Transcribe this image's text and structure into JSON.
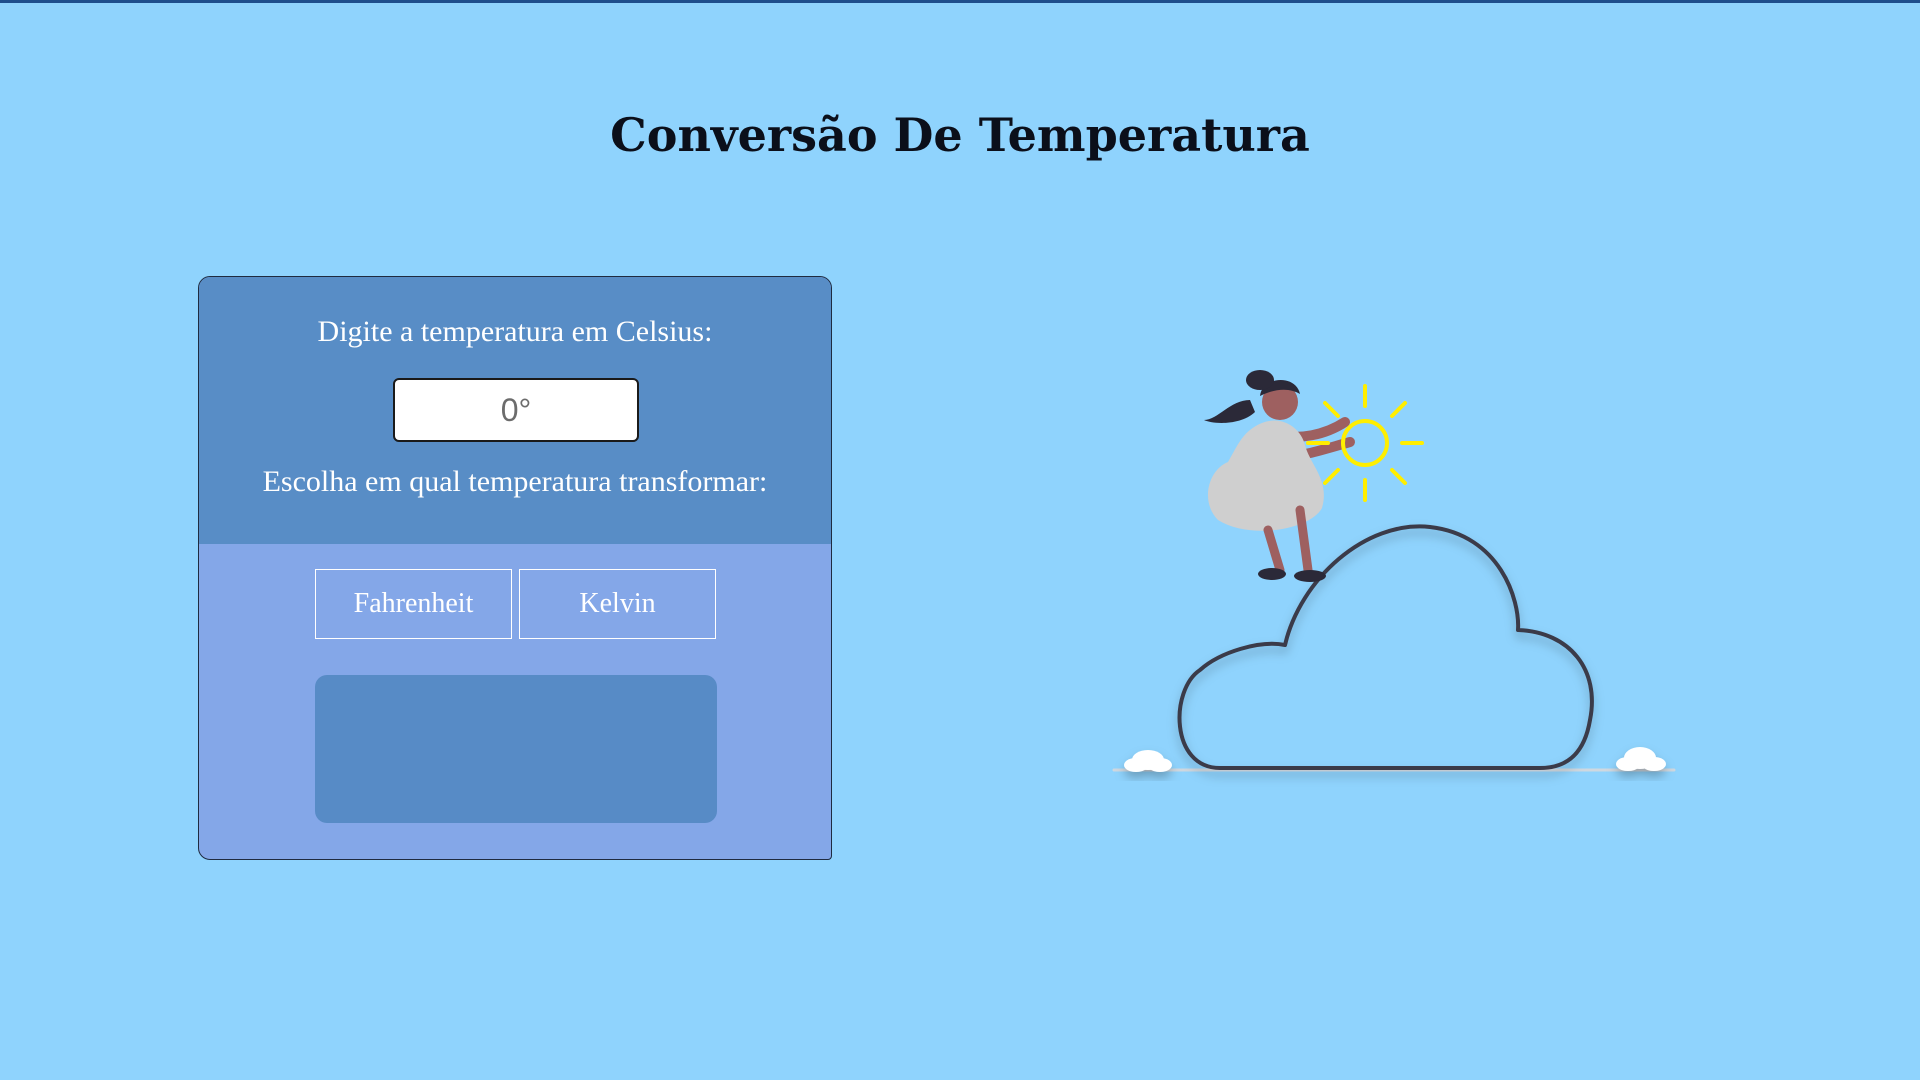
{
  "page": {
    "title": "Conversão De Temperatura"
  },
  "converter": {
    "celsius_label": "Digite a temperatura em Celsius:",
    "input_placeholder": "0°",
    "input_value": "",
    "choose_label": "Escolha em qual temperatura transformar:",
    "buttons": [
      {
        "label": "Fahrenheit"
      },
      {
        "label": "Kelvin"
      }
    ],
    "result": ""
  },
  "colors": {
    "background": "#8fd3fd",
    "card_top": "#588dc6",
    "card_bottom": "#84a7e8",
    "result_box": "#578bc6",
    "sun": "#ffee00"
  },
  "illustration": {
    "icon": "woman-placing-sun-on-cloud-illustration"
  }
}
